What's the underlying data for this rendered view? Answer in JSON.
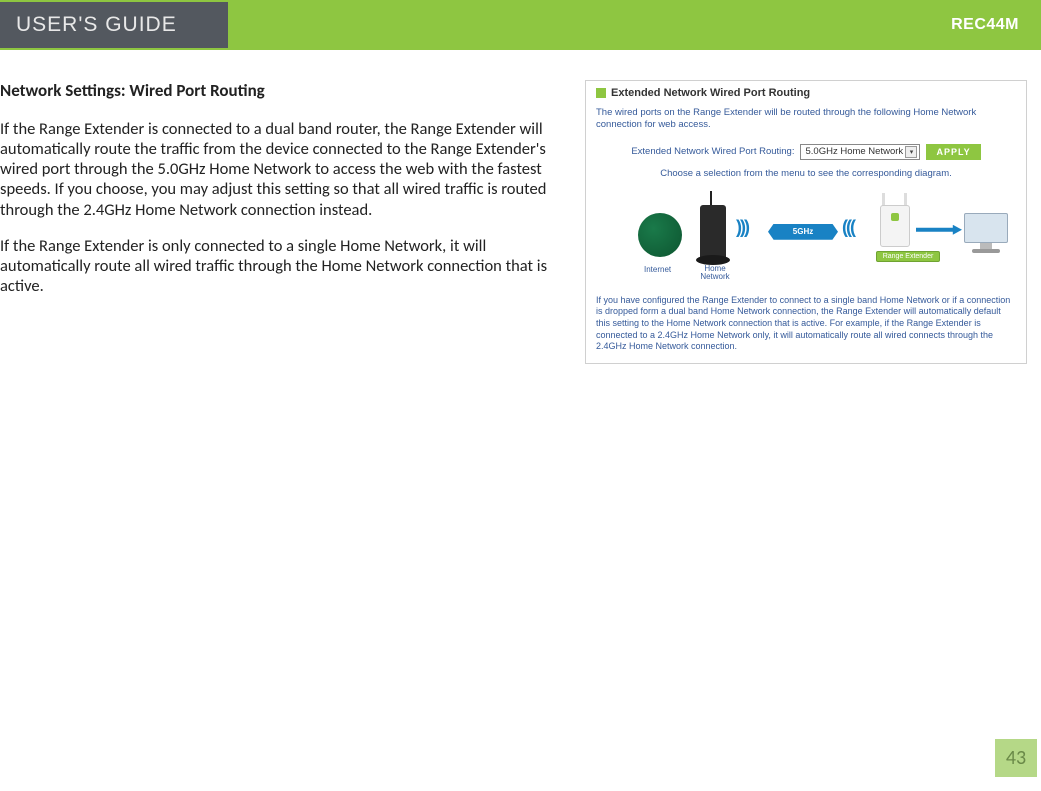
{
  "header": {
    "guide_title": "USER'S GUIDE",
    "model_code": "REC44M"
  },
  "section": {
    "heading": "Network Settings: Wired Port Routing",
    "para1": " If the Range Extender is connected to a dual band router, the Range Extender will automatically route the traffic from the device connected to the Range Extender's wired port through the 5.0GHz Home Network to access the web with the fastest speeds. If you choose, you may adjust this setting so that all wired traffic is routed through the 2.4GHz Home Network connection instead.",
    "para2": "If the Range Extender is only connected to a single Home Network, it will automatically route all wired traffic through the Home Network connection that is active."
  },
  "panel": {
    "title": "Extended Network Wired Port Routing",
    "desc": "The wired ports on the Range Extender will be routed through the following Home Network connection for web access.",
    "form_label": "Extended Network Wired Port Routing:",
    "select_value": "5.0GHz Home Network",
    "apply_label": "APPLY",
    "subdesc": "Choose a selection from the menu to see the corresponding diagram.",
    "diagram": {
      "internet_label": "Internet",
      "home_network_label": "Home Network",
      "band_label": "5GHz",
      "extender_label": "Range Extender"
    },
    "bottom_note": "If you have configured the Range Extender to connect to a single band Home Network or if a connection is dropped form a dual band Home Network connection, the Range Extender will automatically default this setting to the Home Network connection that is active. For example, if the Range Extender is connected to a 2.4GHz Home Network only, it will automatically route all wired connects through the 2.4GHz Home Network connection."
  },
  "page_number": "43"
}
